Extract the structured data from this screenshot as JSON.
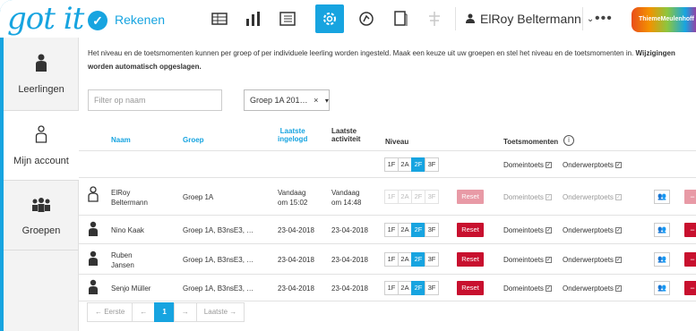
{
  "app": {
    "logo": "got it",
    "logo_badge": "✓",
    "name": "Rekenen"
  },
  "toolbar": {
    "icons": [
      "table-icon",
      "bar-chart-icon",
      "list-icon",
      "settings-icon",
      "target-icon",
      "document-icon",
      "balance-icon"
    ],
    "user_name": "ElRoy Beltermann",
    "more": "•••",
    "brand": "ThiemeMeulenhoff"
  },
  "sidebar": {
    "items": [
      {
        "label": "Leerlingen",
        "icon": "person-icon"
      },
      {
        "label": "Mijn account",
        "icon": "person-outline-icon"
      },
      {
        "label": "Groepen",
        "icon": "group-icon"
      }
    ]
  },
  "intro": {
    "text": "Het niveau en de toetsmomenten kunnen per groep of per individuele leerling worden ingesteld. Maak een keuze uit uw groepen en stel het niveau en de toetsmomenten in.",
    "bold": "Wijzigingen worden automatisch opgeslagen."
  },
  "filter": {
    "placeholder": "Filter op naam",
    "group_value": "Groep 1A 201…",
    "group_clear": "×",
    "group_caret": "▾"
  },
  "table": {
    "headers": {
      "naam": "Naam",
      "groep": "Groep",
      "laatste_ingelogd_1": "Laatste",
      "laatste_ingelogd_2": "ingelogd",
      "laatste_activiteit_1": "Laatste",
      "laatste_activiteit_2": "activiteit",
      "niveau": "Niveau",
      "toetsmomenten": "Toetsmomenten",
      "info": "i"
    },
    "levels": [
      "1F",
      "2A",
      "2F",
      "3F"
    ],
    "reset": "Reset",
    "domeintoets": "Domeintoets",
    "onderwerptoets": "Onderwerptoets",
    "check": "✓",
    "group_button": "👥",
    "delete_button": "−",
    "rows": [
      {
        "name1": "ElRoy",
        "name2": "Beltermann",
        "group": "Groep 1A",
        "login1": "Vandaag",
        "login2": "om 15:02",
        "act1": "Vandaag",
        "act2": "om 14:48"
      },
      {
        "name1": "Nino Kaak",
        "name2": "",
        "group": "Groep 1A, B3nsE3, …",
        "login1": "23-04-2018",
        "login2": "",
        "act1": "23-04-2018",
        "act2": ""
      },
      {
        "name1": "Ruben",
        "name2": "Jansen",
        "group": "Groep 1A, B3nsE3, …",
        "login1": "23-04-2018",
        "login2": "",
        "act1": "23-04-2018",
        "act2": ""
      },
      {
        "name1": "Senjo Müller",
        "name2": "",
        "group": "Groep 1A, B3nsE3, …",
        "login1": "23-04-2018",
        "login2": "",
        "act1": "23-04-2018",
        "act2": ""
      }
    ]
  },
  "pager": {
    "first": "← Eerste",
    "prev": "←",
    "current": "1",
    "next": "→",
    "last": "Laatste →"
  },
  "colors": {
    "accent": "#17a4e0",
    "danger": "#c8102e"
  }
}
